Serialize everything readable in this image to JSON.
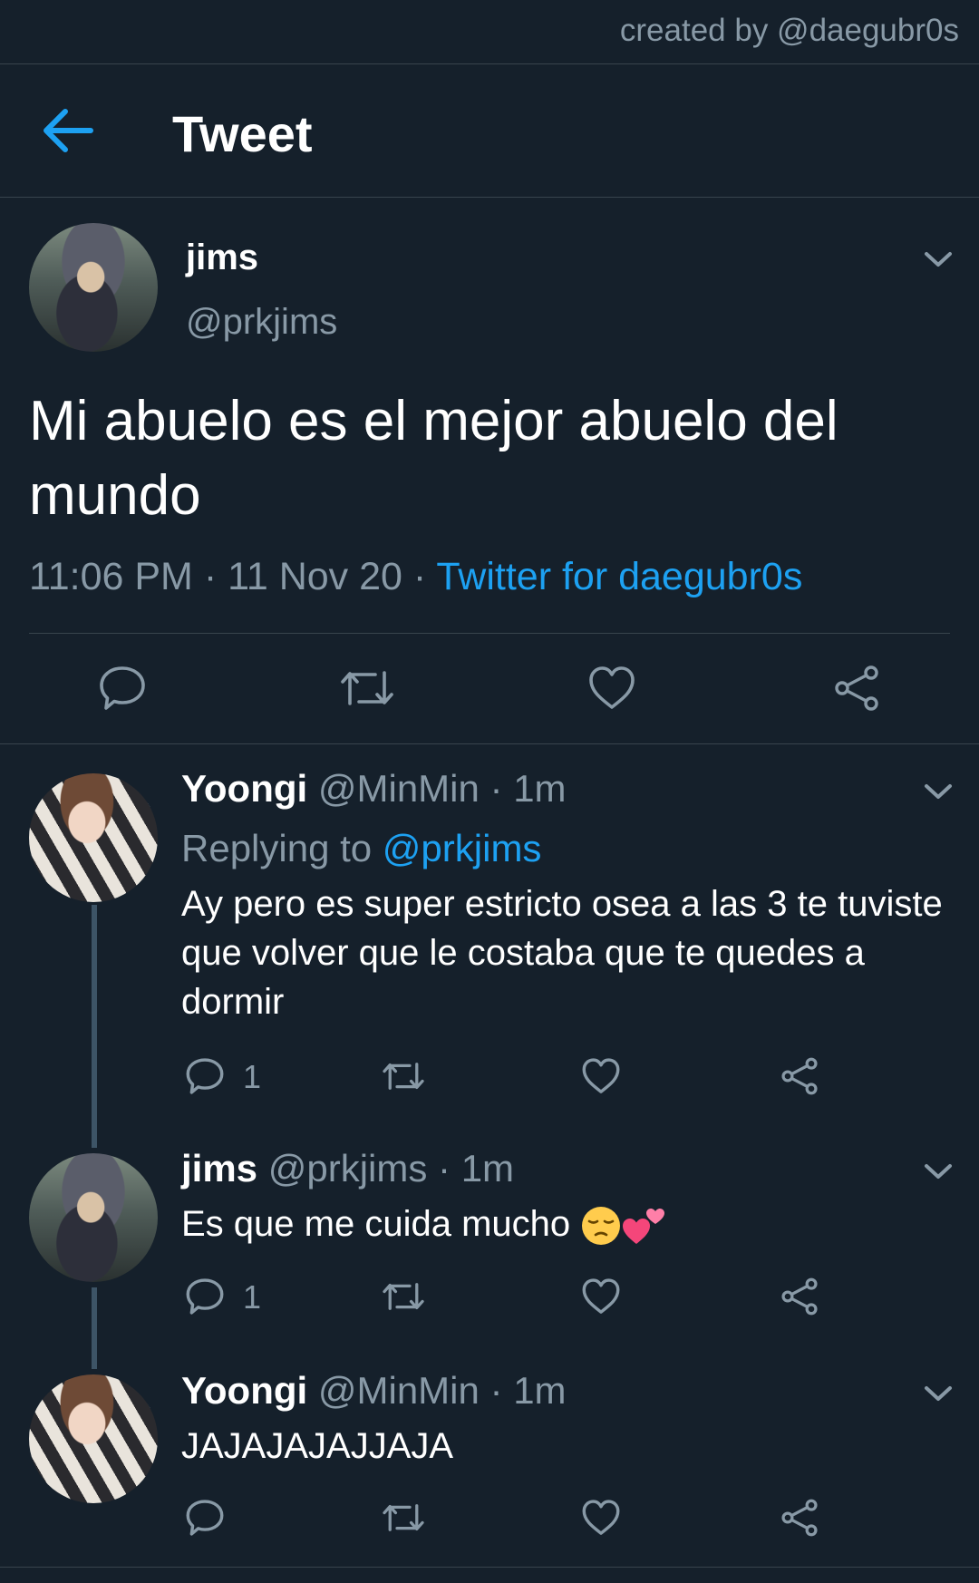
{
  "credit": "created by @daegubr0s",
  "nav": {
    "title": "Tweet"
  },
  "tweet": {
    "name": "jims",
    "handle": "@prkjims",
    "text": "Mi abuelo es el mejor abuelo del mundo",
    "time": "11:06 PM",
    "date": "11 Nov 20",
    "separator": "·",
    "source": "Twitter for daegubr0s"
  },
  "replies": [
    {
      "name": "Yoongi",
      "handle": "@MinMin",
      "age": "1m",
      "replying_label": "Replying to",
      "replying_to": "@prkjims",
      "text": "Ay pero es super estricto osea a las 3 te tuviste que volver que le costaba que te quedes a dormir",
      "reply_count": "1"
    },
    {
      "name": "jims",
      "handle": "@prkjims",
      "age": "1m",
      "text": "Es que me cuida mucho",
      "emojis": [
        "pensive-face-emoji",
        "two-hearts-emoji"
      ],
      "reply_count": "1"
    },
    {
      "name": "Yoongi",
      "handle": "@MinMin",
      "age": "1m",
      "text": "JAJAJAJAJJAJA",
      "reply_count": ""
    }
  ],
  "icons": [
    "back-arrow-icon",
    "chevron-down-icon",
    "reply-icon",
    "retweet-icon",
    "like-icon",
    "share-icon"
  ],
  "colors": {
    "background": "#15202b",
    "accent": "#1da1f2",
    "muted": "#8899a6",
    "divider": "#38444d"
  }
}
